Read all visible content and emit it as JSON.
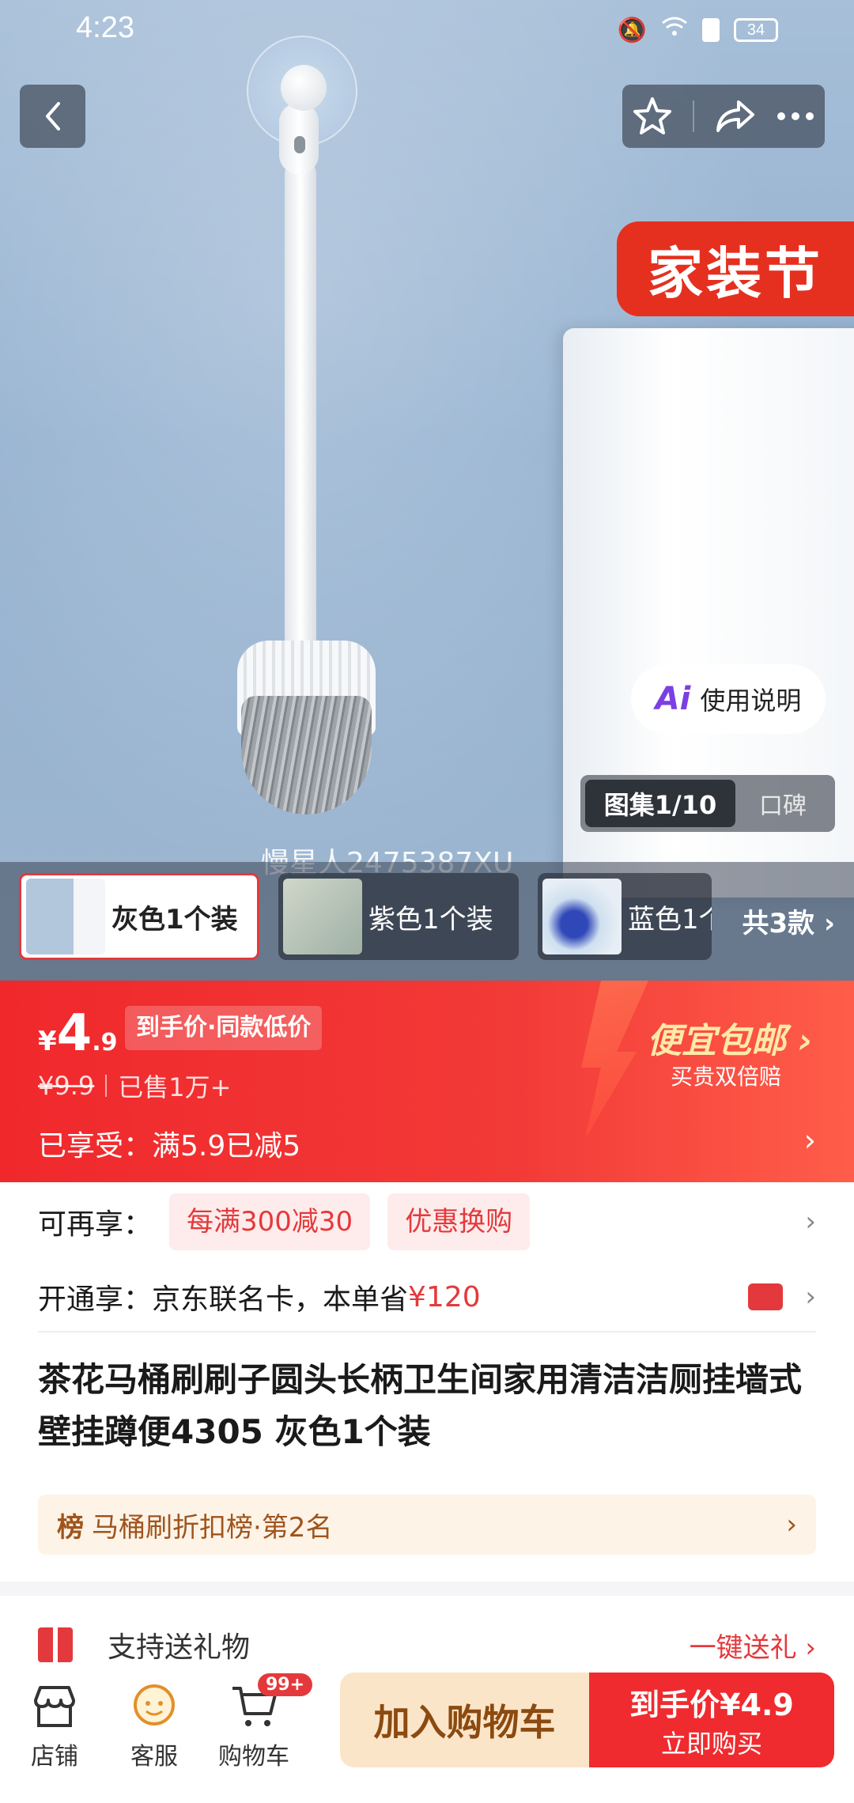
{
  "status_bar": {
    "time": "4:23",
    "battery": "34"
  },
  "hero": {
    "festival_badge": "家装节",
    "instruction_label": "使用说明",
    "ai_label": "Ai",
    "gallery_tab": "图集1/10",
    "reviews_tab": "口碑",
    "watermark": "慢星人2475387XU"
  },
  "variants": [
    {
      "label": "灰色1个装"
    },
    {
      "label": "紫色1个装"
    },
    {
      "label": "蓝色1个"
    }
  ],
  "variants_more": "共3款 ›",
  "price": {
    "currency": "¥",
    "integer": "4",
    "decimal": ".9",
    "tag": "到手价·同款低价",
    "original": "¥9.9",
    "sold": "已售1万+",
    "enjoyed": "已享受：满5.9已减5",
    "free_shipping": "便宜包邮 ›",
    "double_comp": "买贵双倍赔"
  },
  "promo": {
    "more_label": "可再享：",
    "chip1": "每满300减30",
    "chip2": "优惠换购",
    "card_prefix": "开通享：京东联名卡，本单省",
    "card_amount": "¥120"
  },
  "product": {
    "title": "茶花马桶刷刷子圆头长柄卫生间家用清洁洁厕挂墙式壁挂蹲便4305 灰色1个装",
    "rank_tag": "榜",
    "rank_text": "马桶刷折扣榜·第2名"
  },
  "gift": {
    "label": "支持送礼物",
    "link": "一键送礼 ›"
  },
  "bottom_bar": {
    "store": "店铺",
    "service": "客服",
    "cart": "购物车",
    "cart_badge": "99+",
    "add_cart": "加入购物车",
    "buy_price": "到手价¥4.9",
    "buy_now": "立即购买"
  }
}
